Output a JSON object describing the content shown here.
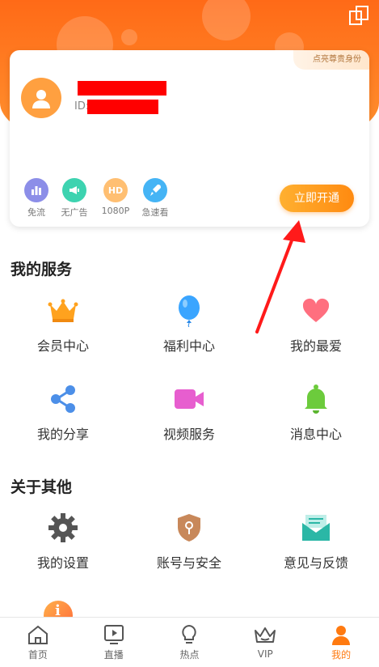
{
  "card": {
    "vip_tag": "点亮尊贵身份",
    "id_label": "ID:",
    "perks": [
      {
        "label": "免流",
        "icon": "bar-chart-icon",
        "color": "#8c8ee8"
      },
      {
        "label": "无广告",
        "icon": "megaphone-icon",
        "color": "#3dd3b0"
      },
      {
        "label": "1080P",
        "icon": "hd-icon",
        "color": "#ffbf72",
        "glyph": "HD"
      },
      {
        "label": "急速看",
        "icon": "rocket-icon",
        "color": "#45b4f5"
      }
    ],
    "open_button": "立即开通"
  },
  "sections": {
    "services_title": "我的服务",
    "services": [
      {
        "label": "会员中心",
        "icon": "crown-icon"
      },
      {
        "label": "福利中心",
        "icon": "balloon-icon"
      },
      {
        "label": "我的最爱",
        "icon": "heart-icon"
      },
      {
        "label": "我的分享",
        "icon": "share-icon"
      },
      {
        "label": "视频服务",
        "icon": "video-camera-icon"
      },
      {
        "label": "消息中心",
        "icon": "bell-icon"
      }
    ],
    "other_title": "关于其他",
    "other": [
      {
        "label": "我的设置",
        "icon": "gear-icon"
      },
      {
        "label": "账号与安全",
        "icon": "shield-icon"
      },
      {
        "label": "意见与反馈",
        "icon": "feedback-mail-icon"
      }
    ]
  },
  "tabbar": [
    {
      "label": "首页",
      "icon": "home-icon"
    },
    {
      "label": "直播",
      "icon": "play-tv-icon"
    },
    {
      "label": "热点",
      "icon": "lightbulb-icon"
    },
    {
      "label": "VIP",
      "icon": "crown-outline-icon"
    },
    {
      "label": "我的",
      "icon": "person-icon",
      "active": true
    }
  ],
  "colors": {
    "accent": "#ff7a10",
    "annotation_arrow": "#ff1a1a"
  }
}
